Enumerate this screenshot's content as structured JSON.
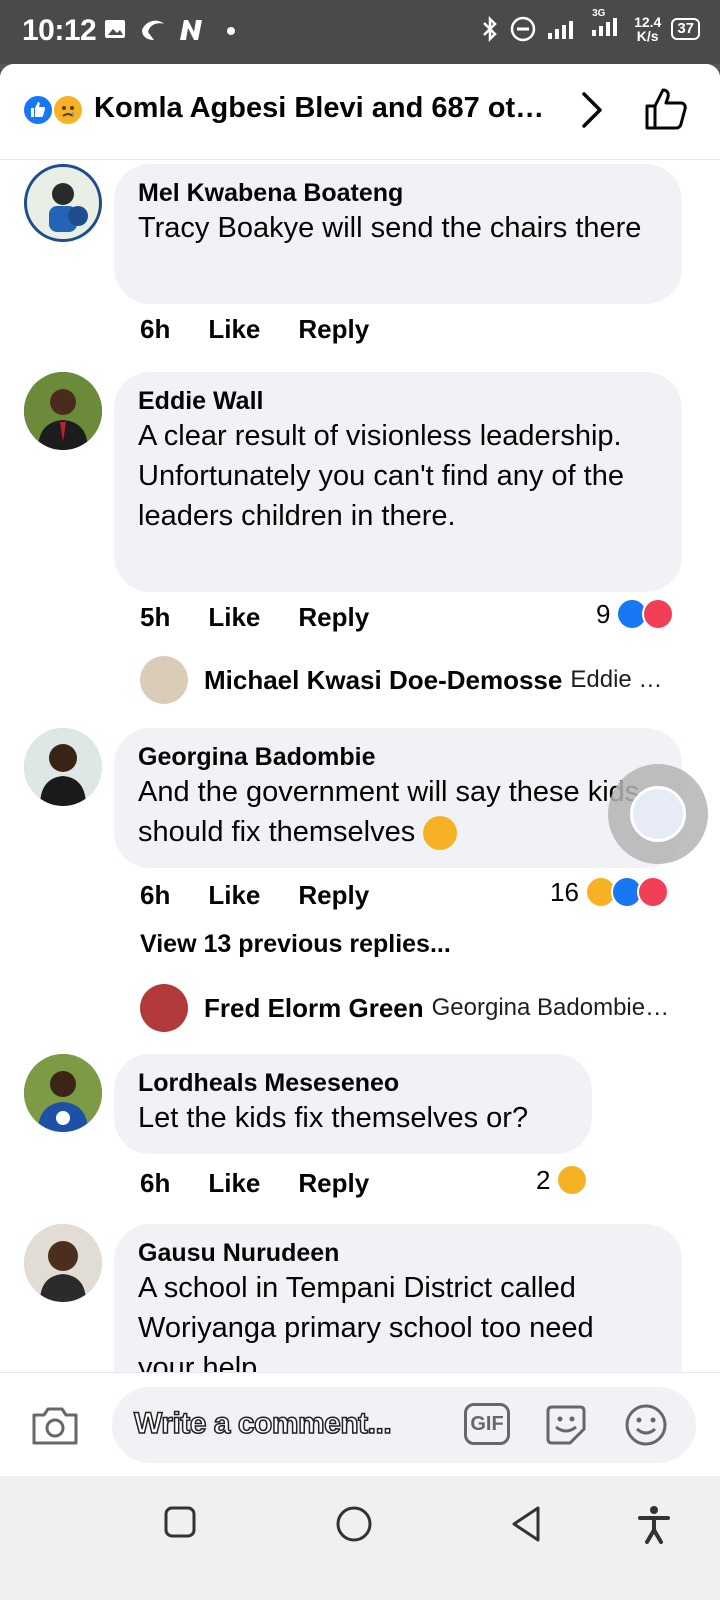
{
  "status_bar": {
    "time": "10:12",
    "speed_value": "12.4",
    "speed_unit": "K/s",
    "battery": "37",
    "network": "3G"
  },
  "header": {
    "title": "Komla Agbesi Blevi and 687 ot…"
  },
  "comments": [
    {
      "author": "Mel Kwabena Boateng",
      "text": "Tracy Boakye will send the chairs there",
      "time": "6h",
      "like_label": "Like",
      "reply_label": "Reply"
    },
    {
      "author": "Eddie Wall",
      "text_line1": "A clear result of visionless leadership.",
      "text_line2": "Unfortunately you can't find any of the leaders children in there.",
      "time": "5h",
      "like_label": "Like",
      "reply_label": "Reply",
      "reaction_count": "9",
      "reply": {
        "author": "Michael Kwasi Doe-Demosse",
        "snippet": "Eddie W…"
      }
    },
    {
      "author": "Georgina Badombie",
      "text": "And the government will say these kids should fix themselves",
      "time": "6h",
      "like_label": "Like",
      "reply_label": "Reply",
      "reaction_count": "16",
      "view_previous": "View 13 previous replies...",
      "reply": {
        "author": "Fred Elorm Green",
        "snippet": "Georgina Badombie…"
      }
    },
    {
      "author": "Lordheals Meseseneo",
      "text": "Let the kids fix themselves or?",
      "time": "6h",
      "like_label": "Like",
      "reply_label": "Reply",
      "reaction_count": "2"
    },
    {
      "author": "Gausu Nurudeen",
      "text": "A school in Tempani District called Woriyanga primary school too need your help"
    }
  ],
  "composer": {
    "placeholder": "Write a comment...",
    "gif_label": "GIF"
  },
  "colors": {
    "like_blue": "#1877f2",
    "love_red": "#f33e58",
    "haha_yellow": "#f7b125",
    "bubble_gray": "#f0f2f5"
  }
}
